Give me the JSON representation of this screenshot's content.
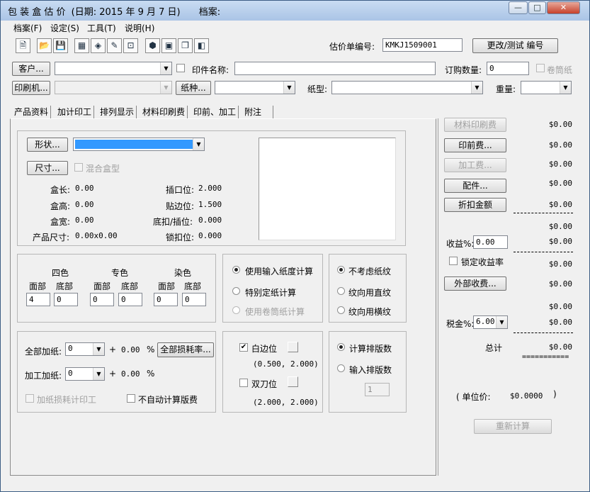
{
  "window": {
    "title_app": "包 装 盒 估 价",
    "title_date": "(日期: 2015 年  9 月  7 日)",
    "title_file": "档案:",
    "min": "—",
    "max": "□",
    "close": "✕"
  },
  "menu": [
    "档案(F)",
    "设定(S)",
    "工具(T)",
    "说明(H)"
  ],
  "toolbar": {
    "icons": [
      "new-icon",
      "open-icon",
      "save-icon",
      "calc-icon",
      "box-icon",
      "edit-icon",
      "chart-icon",
      "package-icon",
      "print-icon",
      "copy-icon",
      "layers-icon"
    ],
    "quote_no_label": "估价单编号:",
    "quote_no_value": "KMKJ1509001",
    "change_button": "更改/测试 编号"
  },
  "header": {
    "customer_button": "客户...",
    "customer_value": "",
    "print_name_label": "印件名称:",
    "print_name_value": "",
    "order_qty_label": "订购数量:",
    "order_qty_value": "0",
    "roll_label": "卷筒纸",
    "printer_button": "印刷机...",
    "paper_kind_button": "纸种...",
    "paper_type_label": "纸型:",
    "weight_label": "重量:"
  },
  "tabs": [
    "产品资料",
    "加计印工",
    "排列显示",
    "材料印刷费",
    "印前、加工",
    "附注"
  ],
  "product": {
    "shape_button": "形状...",
    "size_button": "尺寸...",
    "mixed_label": "混合盒型",
    "left_fields": [
      {
        "label": "盒长:",
        "value": "0.00"
      },
      {
        "label": "盒高:",
        "value": "0.00"
      },
      {
        "label": "盒宽:",
        "value": "0.00"
      },
      {
        "label": "产品尺寸:",
        "value": "0.00x0.00"
      }
    ],
    "right_fields": [
      {
        "label": "插口位:",
        "value": "2.000"
      },
      {
        "label": "贴边位:",
        "value": "1.500"
      },
      {
        "label": "底扣/插位:",
        "value": "0.000"
      },
      {
        "label": "锁扣位:",
        "value": "0.000"
      }
    ]
  },
  "colors": {
    "groups": [
      "四色",
      "专色",
      "染色"
    ],
    "sub": [
      "面部",
      "底部"
    ],
    "values": [
      "4",
      "0",
      "0",
      "0",
      "0",
      "0"
    ]
  },
  "calc_mode": {
    "options": [
      "使用输入纸度计算",
      "特别定纸计算",
      "使用卷筒纸计算"
    ]
  },
  "grain": {
    "options": [
      "不考虑纸纹",
      "纹向用直纹",
      "纹向用横纹"
    ]
  },
  "waste": {
    "all_label": "全部加纸:",
    "all_value": "0",
    "all_pct": "0.00",
    "pct_sign": "%",
    "plus": "+",
    "loss_button": "全部损耗率...",
    "process_label": "加工加纸:",
    "process_value": "0",
    "process_pct": "0.00",
    "loss_print_label": "加纸损耗计印工",
    "no_auto_label": "不自动计算版费"
  },
  "edge": {
    "white_label": "白边位",
    "white_value": "(0.500,  2.000)",
    "double_label": "双刀位",
    "double_value": "(2.000,  2.000)"
  },
  "layout_calc": {
    "options": [
      "计算排版数",
      "输入排版数"
    ],
    "count": "1"
  },
  "costs": {
    "buttons": [
      "材料印刷费",
      "印前费...",
      "加工费...",
      "配件...",
      "折扣金额",
      "外部收费..."
    ],
    "values": [
      "$0.00",
      "$0.00",
      "$0.00",
      "$0.00",
      "$0.00",
      "$0.00",
      "$0.00",
      "$0.00",
      "$0.00",
      "$0.00",
      "$0.00",
      "$0.00"
    ],
    "profit_label": "收益%:",
    "profit_value": "0.00",
    "lock_label": "锁定收益率",
    "tax_label": "税金%:",
    "tax_value": "6.00",
    "total_label": "总计",
    "double_line": "===========",
    "unit_label": "( 单位价:",
    "unit_value": "$0.0000",
    "unit_close": ")",
    "recalc_button": "重新计算"
  }
}
